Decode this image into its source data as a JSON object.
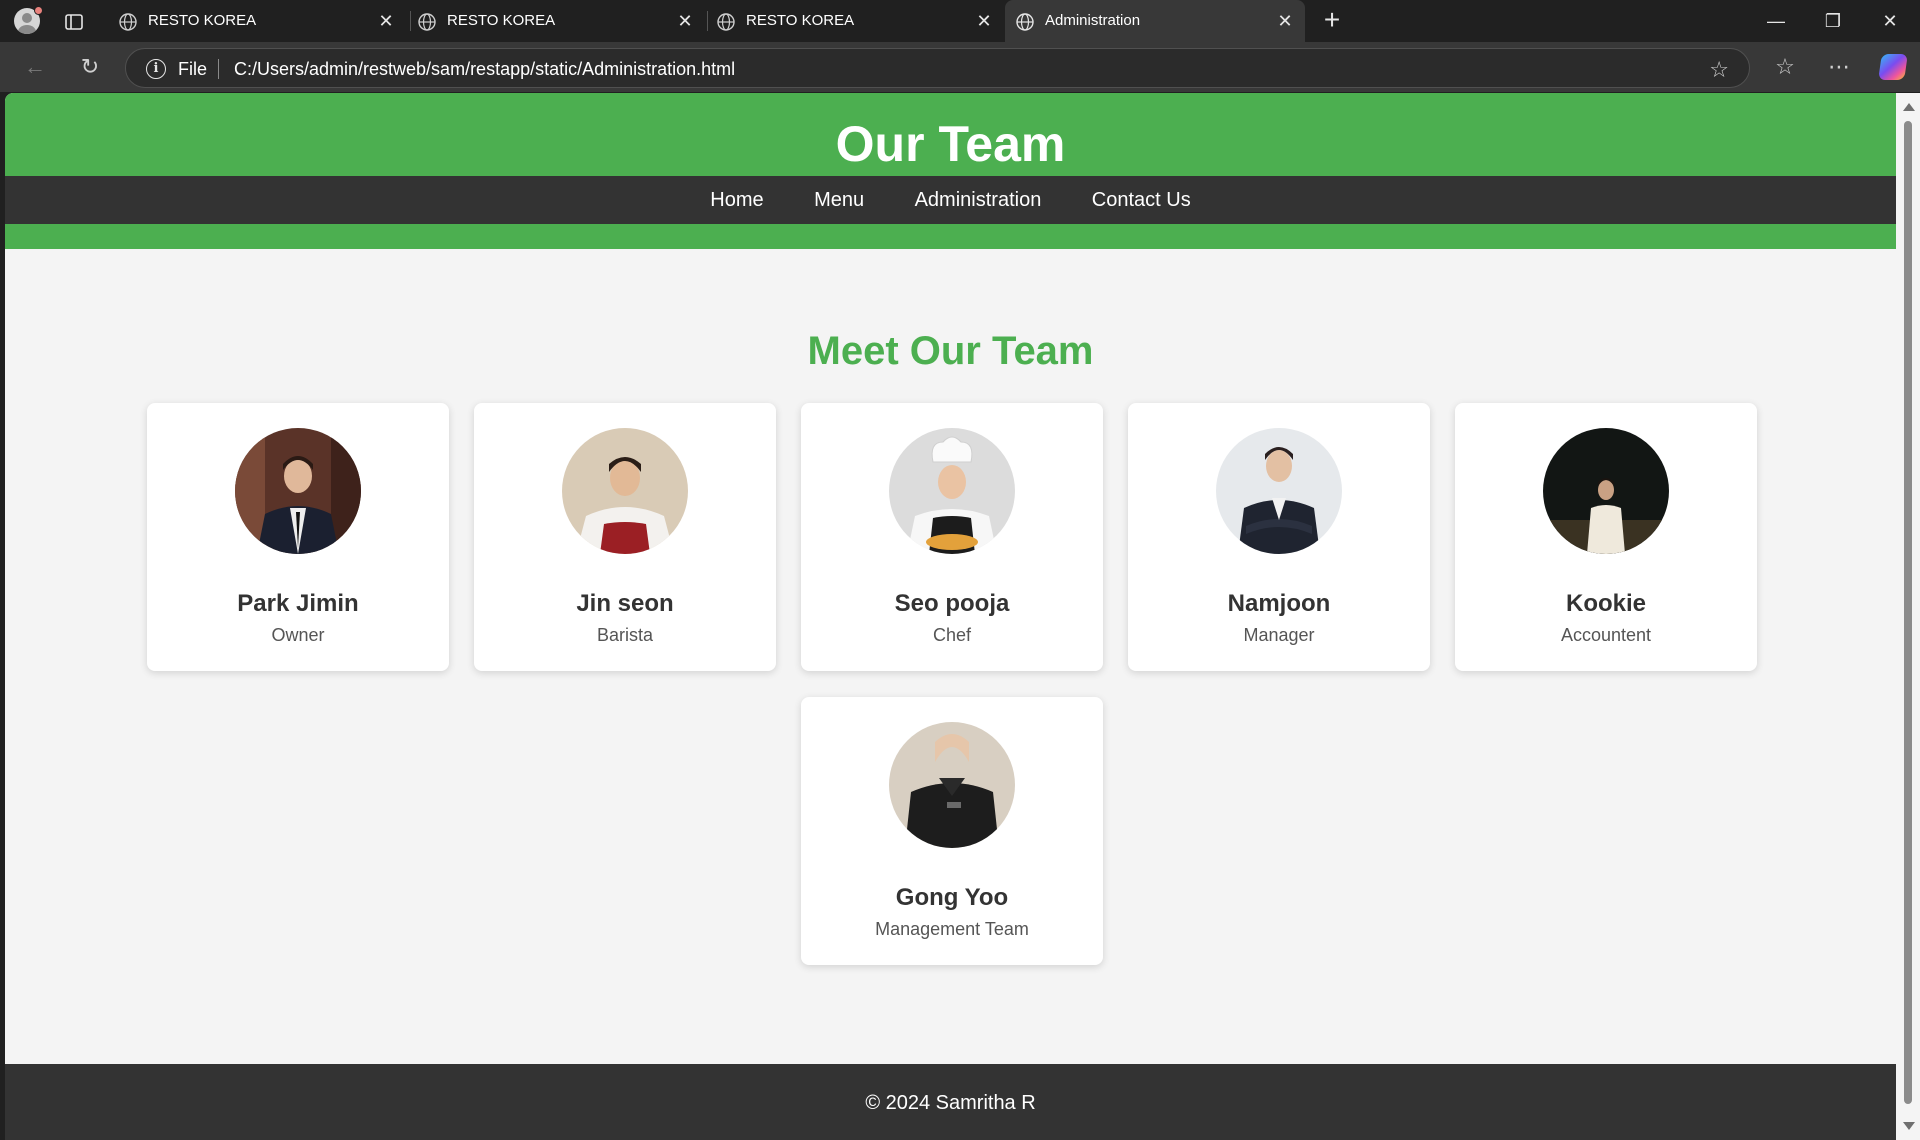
{
  "browser": {
    "tabs": [
      {
        "title": "RESTO KOREA",
        "active": false
      },
      {
        "title": "RESTO KOREA",
        "active": false
      },
      {
        "title": "RESTO KOREA",
        "active": false
      },
      {
        "title": "Administration",
        "active": true
      }
    ],
    "address": {
      "scheme": "File",
      "url": "C:/Users/admin/restweb/sam/restapp/static/Administration.html"
    }
  },
  "header": {
    "title": "Our Team",
    "nav": [
      "Home",
      "Menu",
      "Administration",
      "Contact Us"
    ]
  },
  "main": {
    "section_title": "Meet Our Team",
    "team": [
      {
        "name": "Park Jimin",
        "role": "Owner",
        "photo": "man-in-dark-suit-restaurant"
      },
      {
        "name": "Jin seon",
        "role": "Barista",
        "photo": "man-in-red-apron"
      },
      {
        "name": "Seo pooja",
        "role": "Chef",
        "photo": "woman-chef-with-pizza"
      },
      {
        "name": "Namjoon",
        "role": "Manager",
        "photo": "man-in-suit-arms-crossed"
      },
      {
        "name": "Kookie",
        "role": "Accountent",
        "photo": "man-in-white-shirt-dark-background"
      },
      {
        "name": "Gong Yoo",
        "role": "Management Team",
        "photo": "man-in-black-chef-jacket"
      }
    ]
  },
  "footer": {
    "copyright": "© 2024 Samritha R"
  },
  "colors": {
    "brand_green": "#4caf50",
    "nav_dark": "#333333",
    "page_bg": "#f4f4f4"
  }
}
